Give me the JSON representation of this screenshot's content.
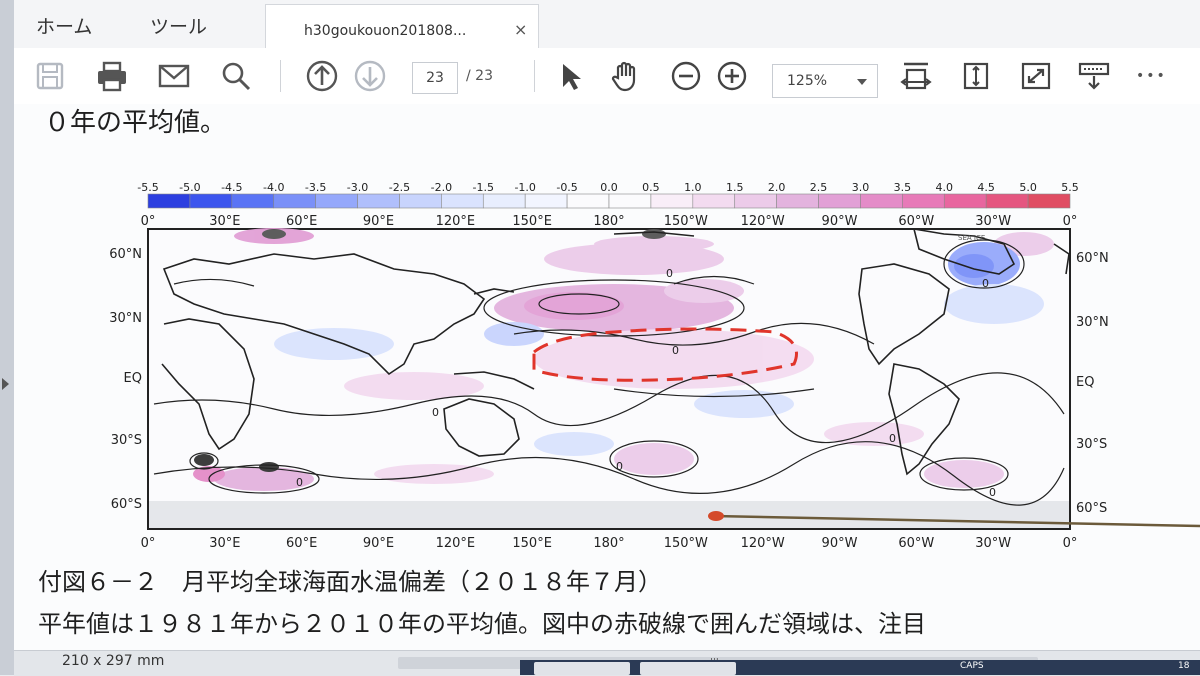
{
  "menu": {
    "home": "ホーム",
    "tools": "ツール"
  },
  "tab": {
    "title": "h30goukouon201808...",
    "close": "×"
  },
  "toolbar": {
    "page_current": "23",
    "page_total": "/ 23",
    "zoom": "125%",
    "icons": [
      "save-icon",
      "print-icon",
      "mail-icon",
      "search-icon",
      "page-up-icon",
      "page-down-icon",
      "select-arrow-icon",
      "hand-icon",
      "zoom-out-icon",
      "zoom-in-icon",
      "fit-width-icon",
      "fit-page-icon",
      "fullscreen-icon",
      "read-mode-icon",
      "more-icon"
    ],
    "more": "•••"
  },
  "document": {
    "top_line": "０年の平均値。",
    "caption": "付図６－２　月平均全球海面水温偏差（２０１８年７月）",
    "body_line": "平年値は１９８１年から２０１０年の平均値。図中の赤破線で囲んだ領域は、注目"
  },
  "chart_data": {
    "type": "map",
    "colorbar": {
      "labels": [
        "-5.5",
        "-5.0",
        "-4.5",
        "-4.0",
        "-3.5",
        "-3.0",
        "-2.5",
        "-2.0",
        "-1.5",
        "-1.0",
        "-0.5",
        "0.0",
        "0.5",
        "1.0",
        "1.5",
        "2.0",
        "2.5",
        "3.0",
        "3.5",
        "4.0",
        "4.5",
        "5.0",
        "5.5"
      ],
      "colors": [
        "#2c3fe0",
        "#3c55ee",
        "#5a74f5",
        "#7a90f8",
        "#95a8fb",
        "#b0bffc",
        "#c8d4fd",
        "#dae3fe",
        "#e8eefe",
        "#f2f5ff",
        "#fbfbfd",
        "#fbfbfd",
        "#f9eef8",
        "#f3dbf0",
        "#eccbe9",
        "#e3b3de",
        "#e2a0d6",
        "#e48cc8",
        "#e77ab8",
        "#e8669f",
        "#e55680",
        "#e04d63"
      ]
    },
    "x_ticks_top": [
      "0°",
      "30°E",
      "60°E",
      "90°E",
      "120°E",
      "150°E",
      "180°",
      "150°W",
      "120°W",
      "90°W",
      "60°W",
      "30°W",
      "0°"
    ],
    "x_ticks_bottom": [
      "0°",
      "30°E",
      "60°E",
      "90°E",
      "120°E",
      "150°E",
      "180°",
      "150°W",
      "120°W",
      "90°W",
      "60°W",
      "30°W",
      "0°"
    ],
    "y_ticks_left": [
      "60°N",
      "30°N",
      "EQ",
      "30°S",
      "60°S"
    ],
    "y_ticks_right": [
      "60°N",
      "30°N",
      "EQ",
      "30°S",
      "60°S"
    ],
    "annotations": [
      "SEA ICE",
      "0"
    ],
    "highlight": "red dashed region, North Pacific"
  },
  "status": {
    "page_size": "210 x 297 mm",
    "grip": "III",
    "caps": "CAPS",
    "clock": "18"
  },
  "colors": {
    "accent_red": "#e0352b",
    "toolbar_bg": "#ffffff",
    "page_bg": "#fbfcfd"
  }
}
